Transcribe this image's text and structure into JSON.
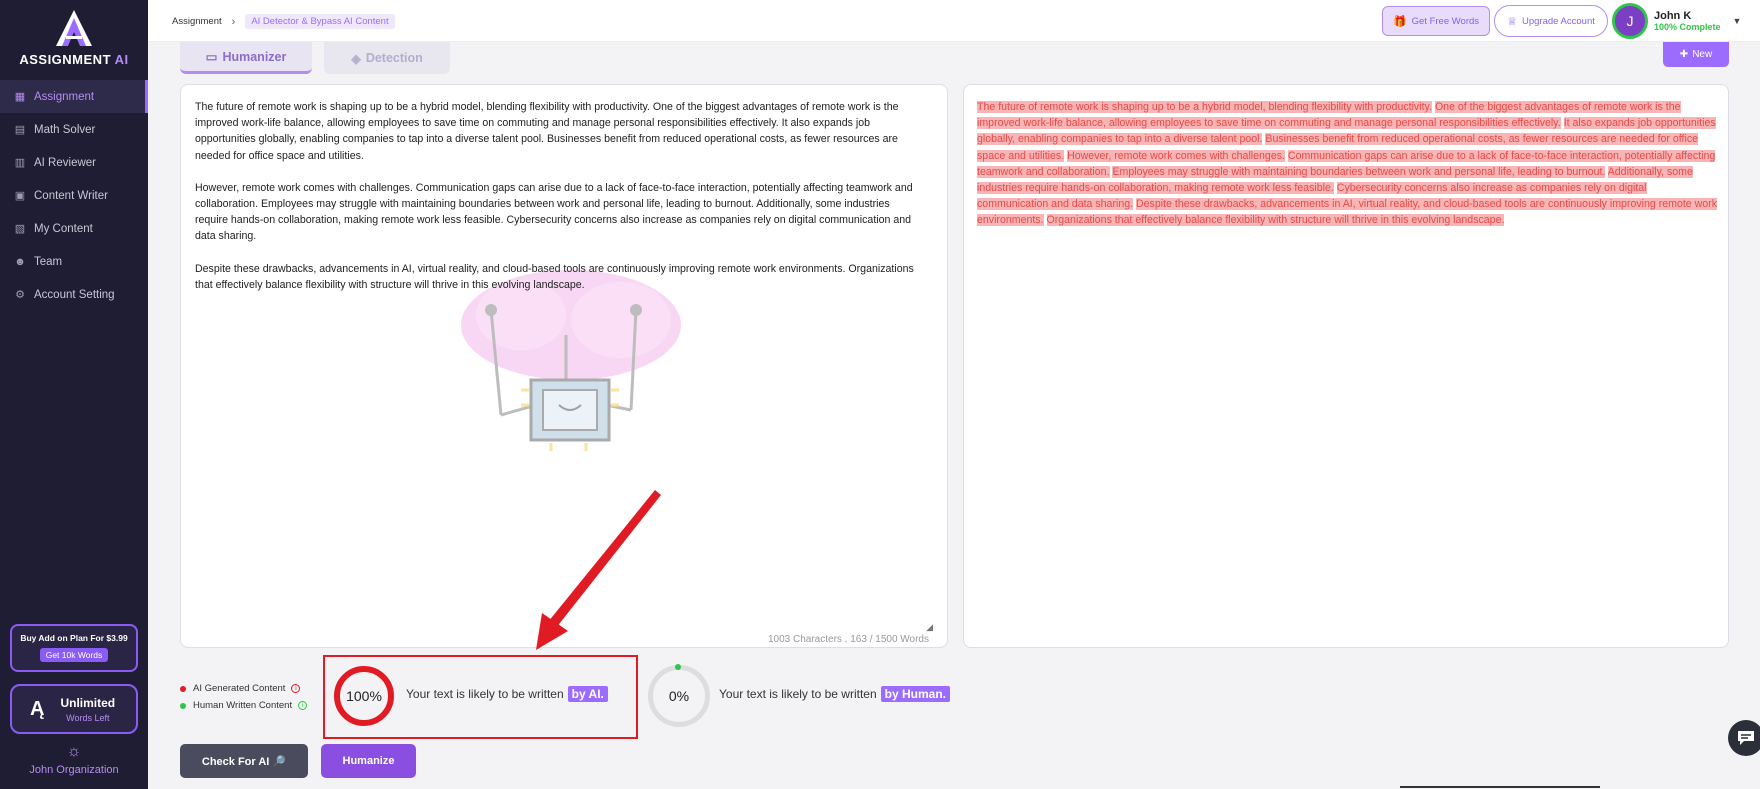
{
  "sidebar": {
    "logo_main": "ASSIGNMENT",
    "logo_ai": "AI",
    "items": [
      {
        "label": "Assignment",
        "icon": "grid-icon"
      },
      {
        "label": "Math Solver",
        "icon": "calculator-icon"
      },
      {
        "label": "AI Reviewer",
        "icon": "reviewer-icon"
      },
      {
        "label": "Content Writer",
        "icon": "document-icon"
      },
      {
        "label": "My Content",
        "icon": "folder-icon"
      },
      {
        "label": "Team",
        "icon": "team-icon"
      },
      {
        "label": "Account Setting",
        "icon": "gear-icon"
      }
    ],
    "addon_title": "Buy Add on Plan For $3.99",
    "addon_button": "Get 10k Words",
    "unlimited_title": "Unlimited",
    "unlimited_sub": "Words Left",
    "org_name": "John Organization"
  },
  "topbar": {
    "breadcrumb_root": "Assignment",
    "breadcrumb_current": "AI Detector & Bypass AI Content",
    "free_words": "Get Free Words",
    "upgrade": "Upgrade Account",
    "user_initial": "J",
    "user_name": "John K",
    "user_status": "100% Complete"
  },
  "tabs": {
    "humanizer": "Humanizer",
    "detection": "Detection",
    "new_button": "New"
  },
  "input": {
    "paragraphs": [
      "The future of remote work is shaping up to be a hybrid model, blending flexibility with productivity. One of the biggest advantages of remote work is the improved work-life balance, allowing employees to save time on commuting and manage personal responsibilities effectively. It also expands job opportunities globally, enabling companies to tap into a diverse talent pool. Businesses benefit from reduced operational costs, as fewer resources are needed for office space and utilities.",
      "However, remote work comes with challenges. Communication gaps can arise due to a lack of face-to-face interaction, potentially affecting teamwork and collaboration. Employees may struggle with maintaining boundaries between work and personal life, leading to burnout. Additionally, some industries require hands-on collaboration, making remote work less feasible. Cybersecurity concerns also increase as companies rely on digital communication and data sharing.",
      "Despite these drawbacks, advancements in AI, virtual reality, and cloud-based tools are continuously improving remote work environments. Organizations that effectively balance flexibility with structure will thrive in this evolving landscape."
    ],
    "counter": "1003 Characters , 163 / 1500 Words"
  },
  "output": {
    "sentences": [
      "The future of remote work is shaping up to be a hybrid model, blending flexibility with productivity.",
      "One of the biggest advantages of remote work is the improved work-life balance, allowing employees to save time on commuting and manage personal responsibilities effectively.",
      "It also expands job opportunities globally, enabling companies to tap into a diverse talent pool.",
      "Businesses benefit from reduced operational costs, as fewer resources are needed for office space and utilities.",
      "However, remote work comes with challenges.",
      "Communication gaps can arise due to a lack of face-to-face interaction, potentially affecting teamwork and collaboration.",
      "Employees may struggle with maintaining boundaries between work and personal life, leading to burnout.",
      "Additionally, some industries require hands-on collaboration, making remote work less feasible.",
      "Cybersecurity concerns also increase as companies rely on digital communication and data sharing.",
      "Despite these drawbacks, advancements in AI, virtual reality, and cloud-based tools are continuously improving remote work environments.",
      "Organizations that effectively balance flexibility with structure will thrive in this evolving landscape."
    ]
  },
  "legend": {
    "ai": "AI Generated Content",
    "human": "Human Written Content"
  },
  "results": {
    "ai_percent": "100%",
    "ai_text": "Your text is likely to be written",
    "ai_tag": "by AI.",
    "human_percent": "0%",
    "human_text": "Your text is likely to be written",
    "human_tag": "by Human."
  },
  "actions": {
    "check": "Check For AI 🔎",
    "humanize": "Humanize"
  },
  "colors": {
    "accent": "#9b6cff",
    "sidebar_bg": "#1f1d33",
    "ai_red": "#e01b24",
    "human_green": "#31c44a",
    "highlight_bg": "#f7b5b5",
    "highlight_text": "#e84a4a"
  }
}
